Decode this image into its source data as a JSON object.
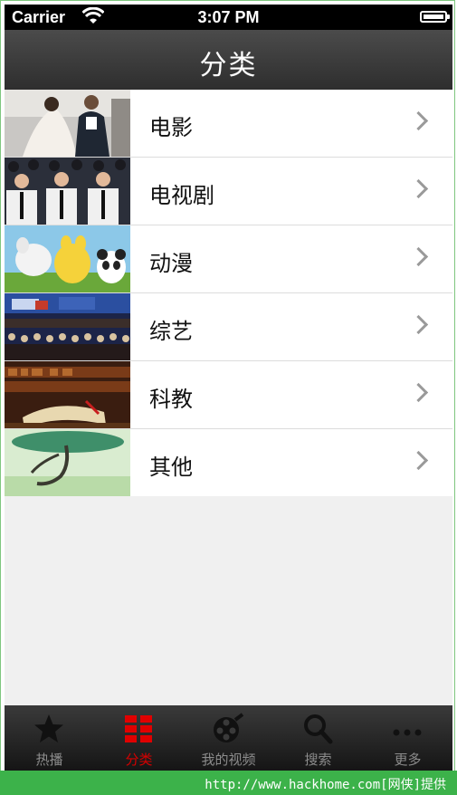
{
  "status_bar": {
    "carrier": "Carrier",
    "time": "3:07 PM"
  },
  "nav": {
    "title": "分类"
  },
  "categories": [
    {
      "label": "电影",
      "thumb": "movie-thumb"
    },
    {
      "label": "电视剧",
      "thumb": "tv-series-thumb"
    },
    {
      "label": "动漫",
      "thumb": "anime-thumb"
    },
    {
      "label": "综艺",
      "thumb": "variety-thumb"
    },
    {
      "label": "科教",
      "thumb": "education-thumb"
    },
    {
      "label": "其他",
      "thumb": "other-thumb"
    }
  ],
  "tabs": [
    {
      "label": "热播",
      "icon": "star-icon",
      "active": false
    },
    {
      "label": "分类",
      "icon": "grid-icon",
      "active": true
    },
    {
      "label": "我的视频",
      "icon": "film-reel-icon",
      "active": false
    },
    {
      "label": "搜索",
      "icon": "search-icon",
      "active": false
    },
    {
      "label": "更多",
      "icon": "more-icon",
      "active": false
    }
  ],
  "footer": {
    "text": "http://www.hackhome.com[网侠]提供"
  },
  "colors": {
    "accent": "#d60000",
    "navbar": "#3a3a3a",
    "footer": "#3cb24a"
  }
}
